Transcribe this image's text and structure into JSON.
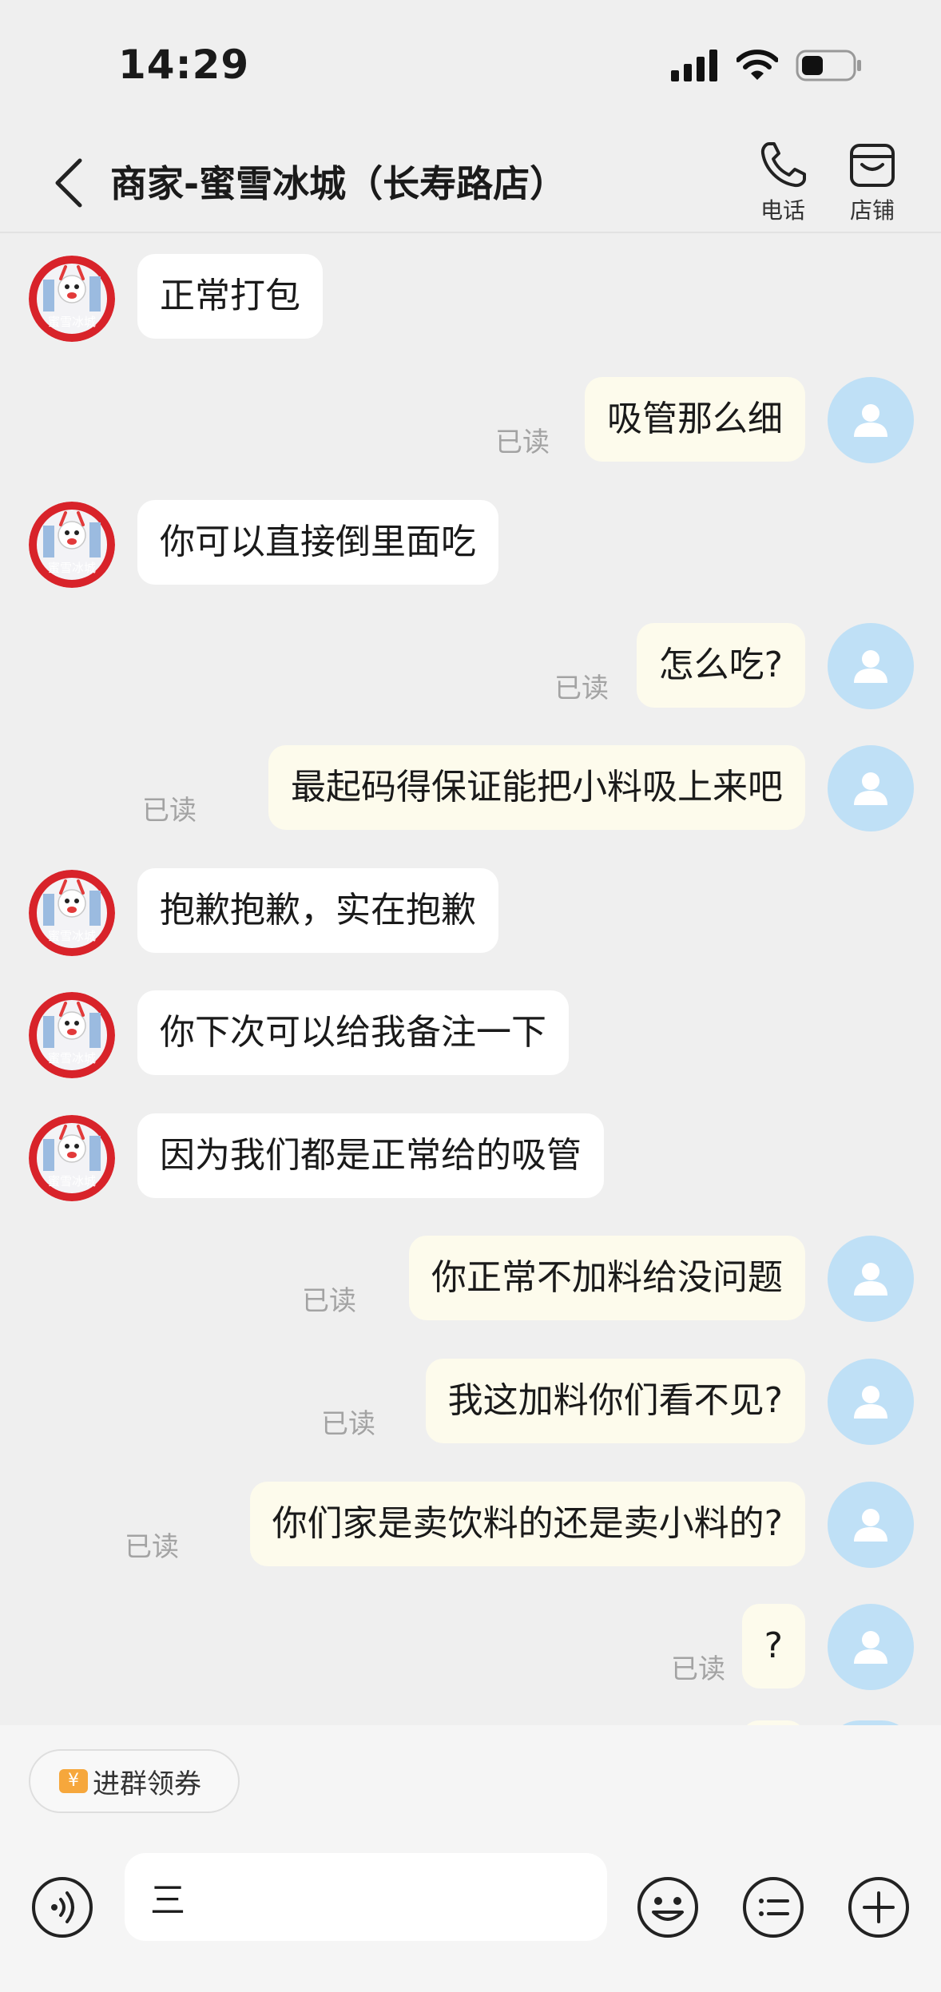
{
  "status": {
    "time": "14:29"
  },
  "header": {
    "title": "商家-蜜雪冰城（长寿路店）",
    "call_label": "电话",
    "store_label": "店铺"
  },
  "messages": [
    {
      "from": "shop",
      "text": "正常打包"
    },
    {
      "from": "user",
      "text": "吸管那么细",
      "status": "已读"
    },
    {
      "from": "shop",
      "text": "你可以直接倒里面吃"
    },
    {
      "from": "user",
      "text": "怎么吃?",
      "status": "已读"
    },
    {
      "from": "user",
      "text": "最起码得保证能把小料吸上来吧",
      "status": "已读"
    },
    {
      "from": "shop",
      "text": "抱歉抱歉，实在抱歉"
    },
    {
      "from": "shop",
      "text": "你下次可以给我备注一下"
    },
    {
      "from": "shop",
      "text": "因为我们都是正常给的吸管"
    },
    {
      "from": "user",
      "text": "你正常不加料给没问题",
      "status": "已读"
    },
    {
      "from": "user",
      "text": "我这加料你们看不见?",
      "status": "已读"
    },
    {
      "from": "user",
      "text": "你们家是卖饮料的还是卖小料的?",
      "status": "已读"
    },
    {
      "from": "user",
      "text": "?",
      "status": "已读"
    }
  ],
  "shop_avatar_text": "蜜雪冰城",
  "coupon": {
    "icon": "¥",
    "label": "进群领券"
  },
  "composer": {
    "value": "三"
  },
  "icons": {
    "back": "chevron-left-icon",
    "call": "phone-icon",
    "store": "store-icon",
    "voice": "voice-icon",
    "emoji": "emoji-icon",
    "menu": "list-icon",
    "add": "plus-icon"
  },
  "colors": {
    "background": "#efefef",
    "incoming_bubble": "#ffffff",
    "outgoing_bubble": "#fdfbec",
    "user_avatar": "#bfe0f6",
    "shop_avatar": "#d8232a",
    "read_text": "#a3a3a3",
    "coupon_icon": "#f6a73c"
  }
}
